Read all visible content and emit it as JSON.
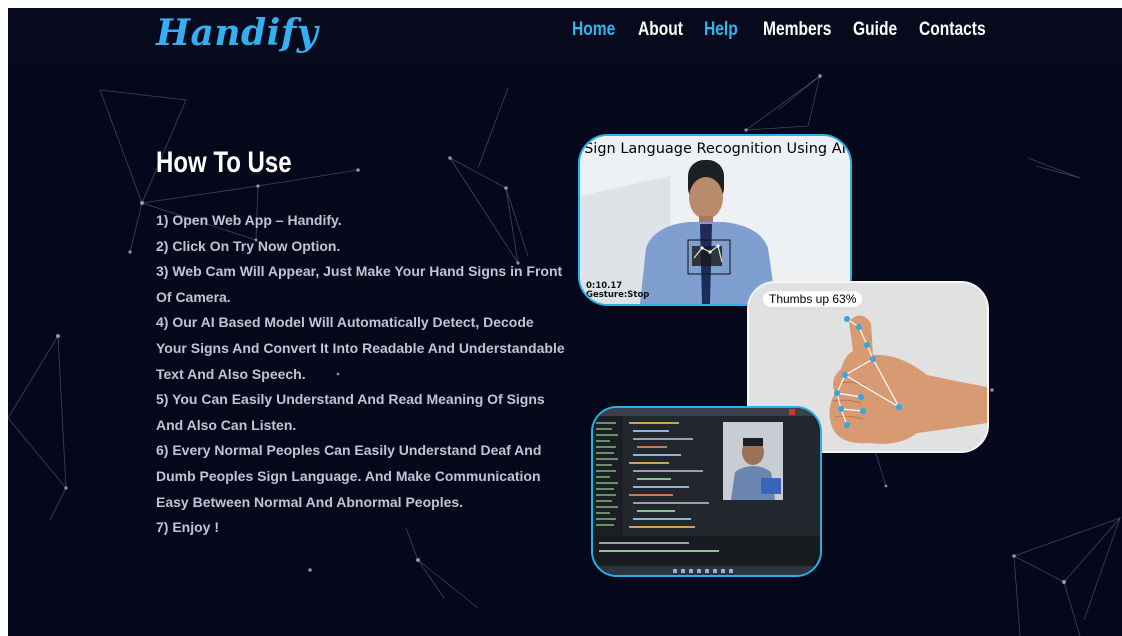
{
  "brand": {
    "logo_text": "Handify"
  },
  "nav": {
    "links": [
      {
        "label": "Home",
        "active": true
      },
      {
        "label": "About",
        "active": false
      },
      {
        "label": "Help",
        "active": true
      },
      {
        "label": "Members",
        "active": false
      },
      {
        "label": "Guide",
        "active": false
      },
      {
        "label": "Contacts",
        "active": false
      }
    ]
  },
  "how_to_use": {
    "title": "How To Use",
    "steps": [
      "1) Open Web App – Handify.",
      "2) Click On Try Now Option.",
      "3) Web Cam Will Appear, Just Make Your Hand Signs in Front Of Camera.",
      "4) Our AI Based Model Will Automatically  Detect, Decode Your Signs And Convert It Into Readable And Understandable Text And Also Speech.",
      "5) You Can Easily Understand And Read Meaning Of Signs And Also Can Listen.",
      "6) Every Normal Peoples Can Easily Understand Deaf And Dumb Peoples Sign Language. And Make Communication Easy Between Normal And Abnormal Peoples.",
      "7) Enjoy !"
    ]
  },
  "images": {
    "webcam_demo": {
      "caption": "Sign Language Recognition Using AI",
      "time_text": "0:10.17",
      "gesture_text": "Gesture:Stop"
    },
    "thumbs_up": {
      "label": "Thumbs up 63%"
    },
    "code_editor": {}
  },
  "colors": {
    "background": "#05081a",
    "accent": "#2fb6ee",
    "text": "#c2c4d0",
    "heading": "#ffffff"
  }
}
